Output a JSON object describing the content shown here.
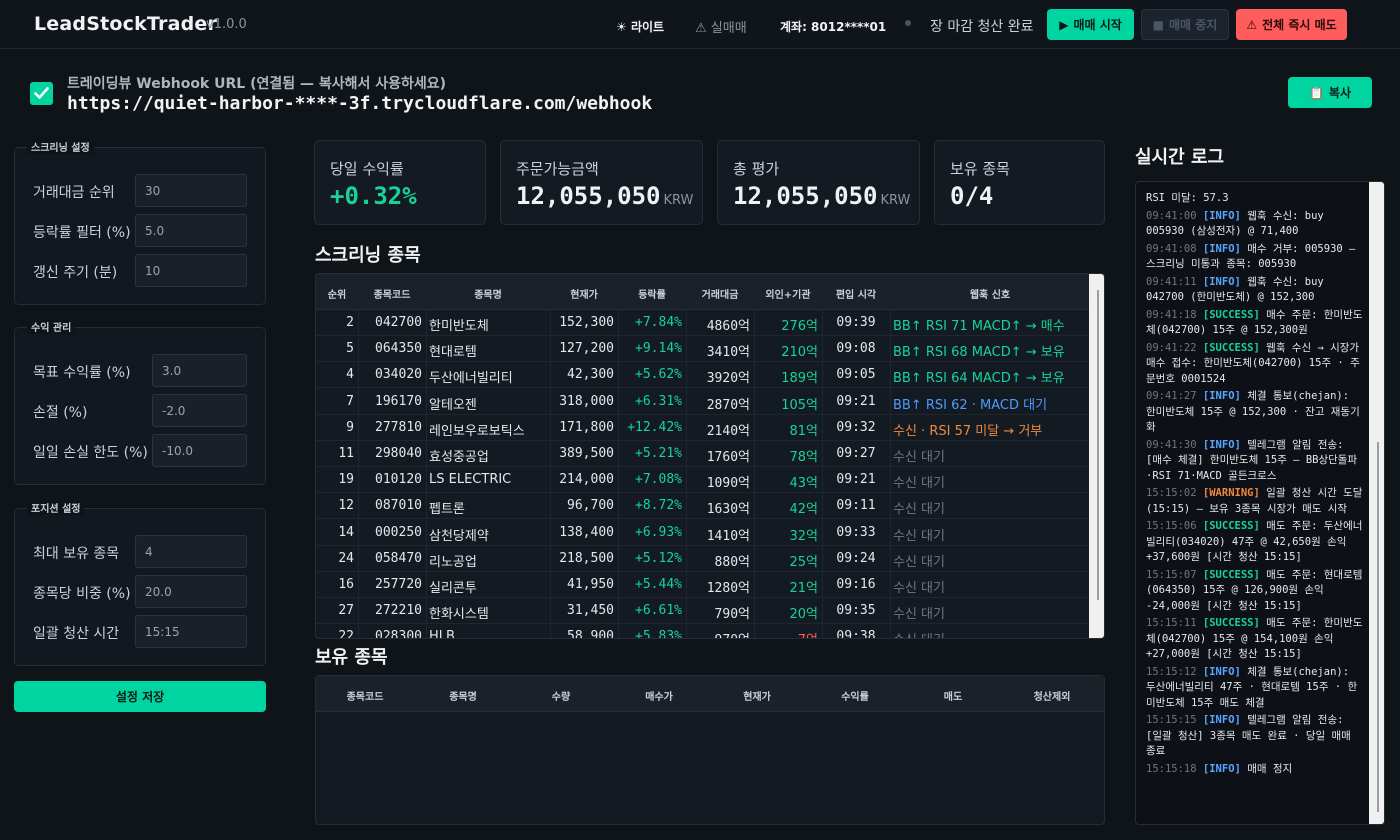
{
  "header": {
    "brand": "LeadStockTrader",
    "version": "v1.0.0",
    "theme_label": "라이트",
    "real_trade_label": "실매매",
    "account": "계좌: 8012****01",
    "market_status": "장 마감 청산 완료",
    "start_label": "매매 시작",
    "stop_label": "매매 중지",
    "sell_all_label": "전체 즉시 매도"
  },
  "webhook": {
    "label": "트레이딩뷰 Webhook URL (연결됨 — 복사해서 사용하세요)",
    "url": "https://quiet-harbor-****-3f.trycloudflare.com/webhook",
    "copy_label": "복사"
  },
  "settings": {
    "screening": {
      "title": "스크리닝 설정",
      "fields": [
        {
          "label": "거래대금 순위",
          "value": "30"
        },
        {
          "label": "등락률 필터 (%)",
          "value": "5.0"
        },
        {
          "label": "갱신 주기 (분)",
          "value": "10"
        }
      ]
    },
    "profit": {
      "title": "수익 관리",
      "fields": [
        {
          "label": "목표 수익률 (%)",
          "value": "3.0"
        },
        {
          "label": "손절 (%)",
          "value": "-2.0"
        },
        {
          "label": "일일 손실 한도 (%)",
          "value": "-10.0"
        }
      ]
    },
    "position": {
      "title": "포지션 설정",
      "fields": [
        {
          "label": "최대 보유 종목",
          "value": "4"
        },
        {
          "label": "종목당 비중 (%)",
          "value": "20.0"
        },
        {
          "label": "일괄 청산 시간",
          "value": "15:15"
        }
      ]
    },
    "save_label": "설정 저장"
  },
  "stats": [
    {
      "label": "당일 수익률",
      "value": "+0.32%",
      "unit": ""
    },
    {
      "label": "주문가능금액",
      "value": "12,055,050",
      "unit": "KRW"
    },
    {
      "label": "총 평가",
      "value": "12,055,050",
      "unit": "KRW"
    },
    {
      "label": "보유 종목",
      "value": "0/4",
      "unit": ""
    }
  ],
  "screening": {
    "title": "스크리닝 종목",
    "columns": [
      "순위",
      "종목코드",
      "종목명",
      "현재가",
      "등락률",
      "거래대금",
      "외인+기관",
      "편입 시각",
      "웹훅 신호"
    ],
    "rows": [
      {
        "rank": "2",
        "code": "042700",
        "name": "한미반도체",
        "price": "152,300",
        "change": "+7.84%",
        "volume": "4860억",
        "foreign": "276억",
        "time": "09:39",
        "signal": "BB↑ RSI 71 MACD↑ → 매수",
        "signal_type": "g"
      },
      {
        "rank": "5",
        "code": "064350",
        "name": "현대로템",
        "price": "127,200",
        "change": "+9.14%",
        "volume": "3410억",
        "foreign": "210억",
        "time": "09:08",
        "signal": "BB↑ RSI 68 MACD↑ → 보유",
        "signal_type": "g"
      },
      {
        "rank": "4",
        "code": "034020",
        "name": "두산에너빌리티",
        "price": "42,300",
        "change": "+5.62%",
        "volume": "3920억",
        "foreign": "189억",
        "time": "09:05",
        "signal": "BB↑ RSI 64 MACD↑ → 보유",
        "signal_type": "g"
      },
      {
        "rank": "7",
        "code": "196170",
        "name": "알테오젠",
        "price": "318,000",
        "change": "+6.31%",
        "volume": "2870억",
        "foreign": "105억",
        "time": "09:21",
        "signal": "BB↑ RSI 62 · MACD 대기",
        "signal_type": "b"
      },
      {
        "rank": "9",
        "code": "277810",
        "name": "레인보우로보틱스",
        "price": "171,800",
        "change": "+12.42%",
        "volume": "2140억",
        "foreign": "81억",
        "time": "09:32",
        "signal": "수신 · RSI 57 미달 → 거부",
        "signal_type": "o"
      },
      {
        "rank": "11",
        "code": "298040",
        "name": "효성중공업",
        "price": "389,500",
        "change": "+5.21%",
        "volume": "1760억",
        "foreign": "78억",
        "time": "09:27",
        "signal": "수신 대기",
        "signal_type": "m"
      },
      {
        "rank": "19",
        "code": "010120",
        "name": "LS ELECTRIC",
        "price": "214,000",
        "change": "+7.08%",
        "volume": "1090억",
        "foreign": "43억",
        "time": "09:21",
        "signal": "수신 대기",
        "signal_type": "m"
      },
      {
        "rank": "12",
        "code": "087010",
        "name": "펩트론",
        "price": "96,700",
        "change": "+8.72%",
        "volume": "1630억",
        "foreign": "42억",
        "time": "09:11",
        "signal": "수신 대기",
        "signal_type": "m"
      },
      {
        "rank": "14",
        "code": "000250",
        "name": "삼천당제약",
        "price": "138,400",
        "change": "+6.93%",
        "volume": "1410억",
        "foreign": "32억",
        "time": "09:33",
        "signal": "수신 대기",
        "signal_type": "m"
      },
      {
        "rank": "24",
        "code": "058470",
        "name": "리노공업",
        "price": "218,500",
        "change": "+5.12%",
        "volume": "880억",
        "foreign": "25억",
        "time": "09:24",
        "signal": "수신 대기",
        "signal_type": "m"
      },
      {
        "rank": "16",
        "code": "257720",
        "name": "실리콘투",
        "price": "41,950",
        "change": "+5.44%",
        "volume": "1280억",
        "foreign": "21억",
        "time": "09:16",
        "signal": "수신 대기",
        "signal_type": "m"
      },
      {
        "rank": "27",
        "code": "272210",
        "name": "한화시스템",
        "price": "31,450",
        "change": "+6.61%",
        "volume": "790억",
        "foreign": "20억",
        "time": "09:35",
        "signal": "수신 대기",
        "signal_type": "m"
      },
      {
        "rank": "22",
        "code": "028300",
        "name": "HLB",
        "price": "58,900",
        "change": "+5.83%",
        "volume": "970억",
        "foreign": "-7억",
        "time": "09:38",
        "signal": "수신 대기",
        "signal_type": "m"
      }
    ]
  },
  "holdings": {
    "title": "보유 종목",
    "columns": [
      "종목코드",
      "종목명",
      "수량",
      "매수가",
      "현재가",
      "수익률",
      "매도",
      "청산제외"
    ]
  },
  "log": {
    "title": "실시간 로그",
    "entries": [
      {
        "ts": "",
        "level": "",
        "text": "RSI 미달: 57.3"
      },
      {
        "ts": "09:41:00",
        "level": "INFO",
        "text": "웹훅 수신: buy 005930 (삼성전자) @ 71,400"
      },
      {
        "ts": "09:41:08",
        "level": "INFO",
        "text": "매수 거부: 005930 — 스크리닝 미통과 종목: 005930"
      },
      {
        "ts": "09:41:11",
        "level": "INFO",
        "text": "웹훅 수신: buy 042700 (한미반도체) @ 152,300"
      },
      {
        "ts": "09:41:18",
        "level": "SUCCESS",
        "text": "매수 주문: 한미반도체(042700) 15주 @ 152,300원"
      },
      {
        "ts": "09:41:22",
        "level": "SUCCESS",
        "text": "웹훅 수신 → 시장가 매수 접수: 한미반도체(042700) 15주 · 주문번호 0001524"
      },
      {
        "ts": "09:41:27",
        "level": "INFO",
        "text": "체결 통보(chejan): 한미반도체 15주 @ 152,300 · 잔고 재동기화"
      },
      {
        "ts": "09:41:30",
        "level": "INFO",
        "text": "텔레그램 알림 전송: [매수 체결] 한미반도체 15주 — BB상단돌파·RSI 71·MACD 골든크로스"
      },
      {
        "ts": "15:15:02",
        "level": "WARNING",
        "text": "일괄 청산 시간 도달 (15:15) — 보유 3종목 시장가 매도 시작"
      },
      {
        "ts": "15:15:06",
        "level": "SUCCESS",
        "text": "매도 주문: 두산에너빌리티(034020) 47주 @ 42,650원 손익 +37,600원 [시간 청산 15:15]"
      },
      {
        "ts": "15:15:07",
        "level": "SUCCESS",
        "text": "매도 주문: 현대로템(064350) 15주 @ 126,900원 손익 -24,000원 [시간 청산 15:15]"
      },
      {
        "ts": "15:15:11",
        "level": "SUCCESS",
        "text": "매도 주문: 한미반도체(042700) 15주 @ 154,100원 손익 +27,000원 [시간 청산 15:15]"
      },
      {
        "ts": "15:15:12",
        "level": "INFO",
        "text": "체결 통보(chejan): 두산에너빌리티 47주 · 현대로템 15주 · 한미반도체 15주 매도 체결"
      },
      {
        "ts": "15:15:15",
        "level": "INFO",
        "text": "텔레그램 알림 전송: [일괄 청산] 3종목 매도 완료 · 당일 매매 종료"
      },
      {
        "ts": "15:15:18",
        "level": "INFO",
        "text": "매매 정지"
      }
    ]
  },
  "colors": {
    "accent": "#00d4a0",
    "danger": "#ff5c5c",
    "background": "#0f1419"
  }
}
